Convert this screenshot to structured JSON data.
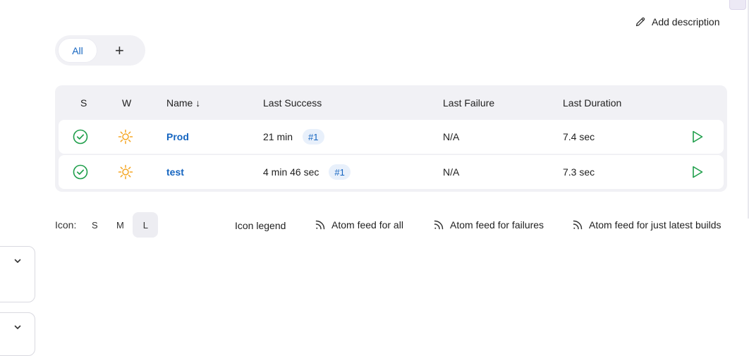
{
  "header": {
    "add_description_label": "Add description"
  },
  "tabs": {
    "all_label": "All",
    "add_label": "+"
  },
  "table": {
    "columns": {
      "s": "S",
      "w": "W",
      "name": "Name ↓",
      "last_success": "Last Success",
      "last_failure": "Last Failure",
      "last_duration": "Last Duration"
    },
    "rows": [
      {
        "name": "Prod",
        "last_success": "21 min",
        "build": "#1",
        "last_failure": "N/A",
        "last_duration": "7.4 sec",
        "status_icon": "success-check-icon",
        "weather_icon": "sunny-icon"
      },
      {
        "name": "test",
        "last_success": "4 min 46 sec",
        "build": "#1",
        "last_failure": "N/A",
        "last_duration": "7.3 sec",
        "status_icon": "success-check-icon",
        "weather_icon": "sunny-icon"
      }
    ]
  },
  "footer": {
    "icon_label": "Icon:",
    "sizes": [
      "S",
      "M",
      "L"
    ],
    "selected_size": "L",
    "icon_legend": "Icon legend",
    "atom_all": "Atom feed for all",
    "atom_failures": "Atom feed for failures",
    "atom_latest": "Atom feed for just latest builds"
  },
  "colors": {
    "link": "#1565c0",
    "success": "#1e9e4a",
    "sun": "#f5a623",
    "panel": "#f1f1f5"
  }
}
